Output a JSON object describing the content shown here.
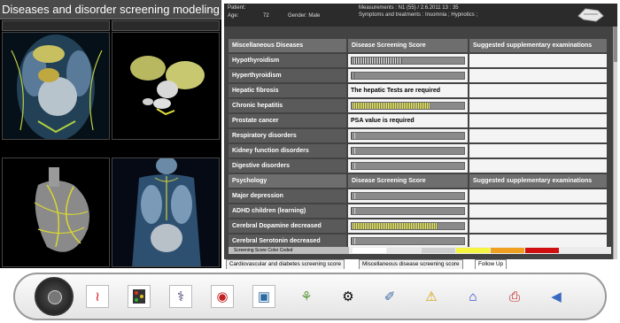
{
  "left_panel": {
    "title": "Diseases and disorder screening modeling"
  },
  "patient": {
    "patient_label": "Patient:",
    "age_label": "Age:",
    "age": "72",
    "gender": "Gender: Male",
    "measurements": "Measurements :      N1 (55) / 2.6.2011  13 : 35",
    "symptoms": "Symptoms and treatments : Insomnia ; Hypnotics ;"
  },
  "section1": {
    "title": "Miscellaneous Diseases",
    "score_header": "Disease Screening Score",
    "supp_header": "Suggested supplementary examinations",
    "rows": [
      {
        "label": "Hypothyroidism",
        "score": 0.45,
        "color": "gray",
        "text": ""
      },
      {
        "label": "Hyperthyroidism",
        "score": 0.02,
        "color": "gray",
        "text": ""
      },
      {
        "label": "Hepatic fibrosis",
        "score": null,
        "color": "",
        "text": "The hepatic Tests are required"
      },
      {
        "label": "Chronic hepatitis",
        "score": 0.7,
        "color": "yellow",
        "text": ""
      },
      {
        "label": "Prostate cancer",
        "score": null,
        "color": "",
        "text": "PSA value is required"
      },
      {
        "label": "Respiratory disorders",
        "score": 0.03,
        "color": "gray",
        "text": ""
      },
      {
        "label": "Kidney function disorders",
        "score": 0.03,
        "color": "gray",
        "text": ""
      },
      {
        "label": "Digestive disorders",
        "score": 0.03,
        "color": "gray",
        "text": ""
      }
    ]
  },
  "section2": {
    "title": "Psychology",
    "score_header": "Disease Screening Score",
    "supp_header": "Suggested supplementary examinations",
    "rows": [
      {
        "label": "Major depression",
        "score": 0.03,
        "color": "gray",
        "text": ""
      },
      {
        "label": "ADHD children (learning)",
        "score": 0.03,
        "color": "gray",
        "text": ""
      },
      {
        "label": "Cerebral Dopamine decreased",
        "score": 0.76,
        "color": "yellow",
        "text": ""
      },
      {
        "label": "Cerebral Serotonin decreased",
        "score": 0.03,
        "color": "gray",
        "text": ""
      }
    ]
  },
  "legend": {
    "label": "Screening Score Color Coded",
    "colors": [
      "#ffffff",
      "#e6e6e6",
      "#cfcfcf",
      "#f5f542",
      "#f0a020",
      "#d01010"
    ]
  },
  "tabs": [
    "Cardiovascular and diabetes screening score",
    "Miscellaneous disease screening score",
    "Follow Up"
  ],
  "toolbar_icons": [
    "jog-dial",
    "blood-vessel-icon",
    "traffic-light-icon",
    "microscope-icon",
    "pills-icon",
    "monitor-icon",
    "plant-icon",
    "runner-icon",
    "syringe-icon",
    "warning-icon",
    "home-icon",
    "pdf-icon",
    "back-icon"
  ]
}
